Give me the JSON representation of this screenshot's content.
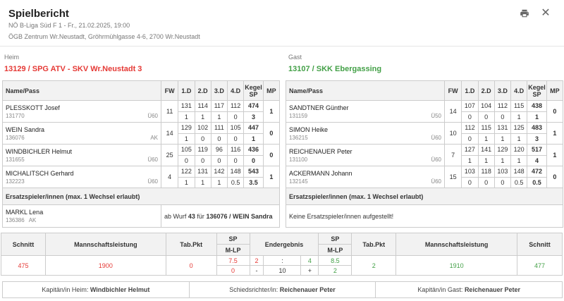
{
  "header": {
    "title": "Spielbericht",
    "league_date": "NÖ B-Liga Süd F 1 - Fr., 21.02.2025, 19:00",
    "venue": "ÖGB Zentrum Wr.Neustadt, Gröhrmühlgasse 4-6, 2700 Wr.Neustadt",
    "print_icon": "print-icon",
    "close_icon": "close-icon"
  },
  "colors": {
    "home": "#e53935",
    "away": "#43a047"
  },
  "home": {
    "side_label": "Heim",
    "team": "13129 / SPG ATV - SKV Wr.Neustadt 3",
    "cols": [
      "Name/Pass",
      "FW",
      "1.D",
      "2.D",
      "3.D",
      "4.D",
      "Kegel SP",
      "MP"
    ],
    "players": [
      {
        "name": "PLESSKOTT Josef",
        "pass": "131770",
        "cat": "Ü60",
        "fw": "11",
        "d": [
          "131",
          "114",
          "117",
          "112"
        ],
        "kegel": "474",
        "sp": [
          "1",
          "1",
          "1",
          "0"
        ],
        "sp_total": "3",
        "mp": "1"
      },
      {
        "name": "WEIN Sandra",
        "pass": "136076",
        "cat": "AK",
        "fw": "14",
        "d": [
          "129",
          "102",
          "111",
          "105"
        ],
        "kegel": "447",
        "sp": [
          "1",
          "0",
          "0",
          "0"
        ],
        "sp_total": "1",
        "mp": "0"
      },
      {
        "name": "WINDBICHLER Helmut",
        "pass": "131655",
        "cat": "Ü60",
        "fw": "25",
        "d": [
          "105",
          "119",
          "96",
          "116"
        ],
        "kegel": "436",
        "sp": [
          "0",
          "0",
          "0",
          "0"
        ],
        "sp_total": "0",
        "mp": "0"
      },
      {
        "name": "MICHALITSCH Gerhard",
        "pass": "132223",
        "cat": "Ü60",
        "fw": "4",
        "d": [
          "122",
          "131",
          "142",
          "148"
        ],
        "kegel": "543",
        "sp": [
          "1",
          "1",
          "1",
          "0.5"
        ],
        "sp_total": "3.5",
        "mp": "1"
      }
    ],
    "subs_header": "Ersatzspieler/innen (max. 1 Wechsel erlaubt)",
    "sub": {
      "name": "MARKL Lena",
      "pass": "136386",
      "cat": "AK",
      "text_pre": "ab Wurf",
      "wurf": "43",
      "text_mid": "für",
      "target": "136076 / WEIN Sandra"
    }
  },
  "away": {
    "side_label": "Gast",
    "team": "13107 / SKK Ebergassing",
    "cols": [
      "Name/Pass",
      "FW",
      "1.D",
      "2.D",
      "3.D",
      "4.D",
      "Kegel SP",
      "MP"
    ],
    "players": [
      {
        "name": "SANDTNER Günther",
        "pass": "131159",
        "cat": "Ü50",
        "fw": "14",
        "d": [
          "107",
          "104",
          "112",
          "115"
        ],
        "kegel": "438",
        "sp": [
          "0",
          "0",
          "0",
          "1"
        ],
        "sp_total": "1",
        "mp": "0"
      },
      {
        "name": "SIMON Heike",
        "pass": "136215",
        "cat": "Ü60",
        "fw": "10",
        "d": [
          "112",
          "115",
          "131",
          "125"
        ],
        "kegel": "483",
        "sp": [
          "0",
          "1",
          "1",
          "1"
        ],
        "sp_total": "3",
        "mp": "1"
      },
      {
        "name": "REICHENAUER Peter",
        "pass": "131100",
        "cat": "Ü60",
        "fw": "7",
        "d": [
          "127",
          "141",
          "129",
          "120"
        ],
        "kegel": "517",
        "sp": [
          "1",
          "1",
          "1",
          "1"
        ],
        "sp_total": "4",
        "mp": "1"
      },
      {
        "name": "ACKERMANN Johann",
        "pass": "132145",
        "cat": "Ü60",
        "fw": "15",
        "d": [
          "103",
          "118",
          "103",
          "148"
        ],
        "kegel": "472",
        "sp": [
          "0",
          "0",
          "0",
          "0.5"
        ],
        "sp_total": "0.5",
        "mp": "0"
      }
    ],
    "subs_header": "Ersatzspieler/innen (max. 1 Wechsel erlaubt)",
    "no_subs": "Keine Ersatzspieler/innen aufgestellt!"
  },
  "summary": {
    "cols": [
      "Schnitt",
      "Mannschaftsleistung",
      "Tab.Pkt",
      "SP",
      "M-LP",
      "Endergebnis",
      "SP",
      "M-LP",
      "Tab.Pkt",
      "Mannschaftsleistung",
      "Schnitt"
    ],
    "home_schnitt": "475",
    "home_leistung": "1900",
    "home_tab": "0",
    "home_sp": "7.5",
    "home_mlp": "0",
    "end_home": "2",
    "end_sep": ":",
    "end_away": "4",
    "end_minus": "-",
    "end_diff": "10",
    "end_plus": "+",
    "away_sp": "8.5",
    "away_mlp": "2",
    "away_tab": "2",
    "away_leistung": "1910",
    "away_schnitt": "477"
  },
  "footer": {
    "captain_home_label": "Kapitän/in Heim:",
    "captain_home": "Windbichler Helmut",
    "referee_label": "Schiedsrichter/in:",
    "referee": "Reichenauer Peter",
    "captain_away_label": "Kapitän/in Gast:",
    "captain_away": "Reichenauer Peter"
  }
}
